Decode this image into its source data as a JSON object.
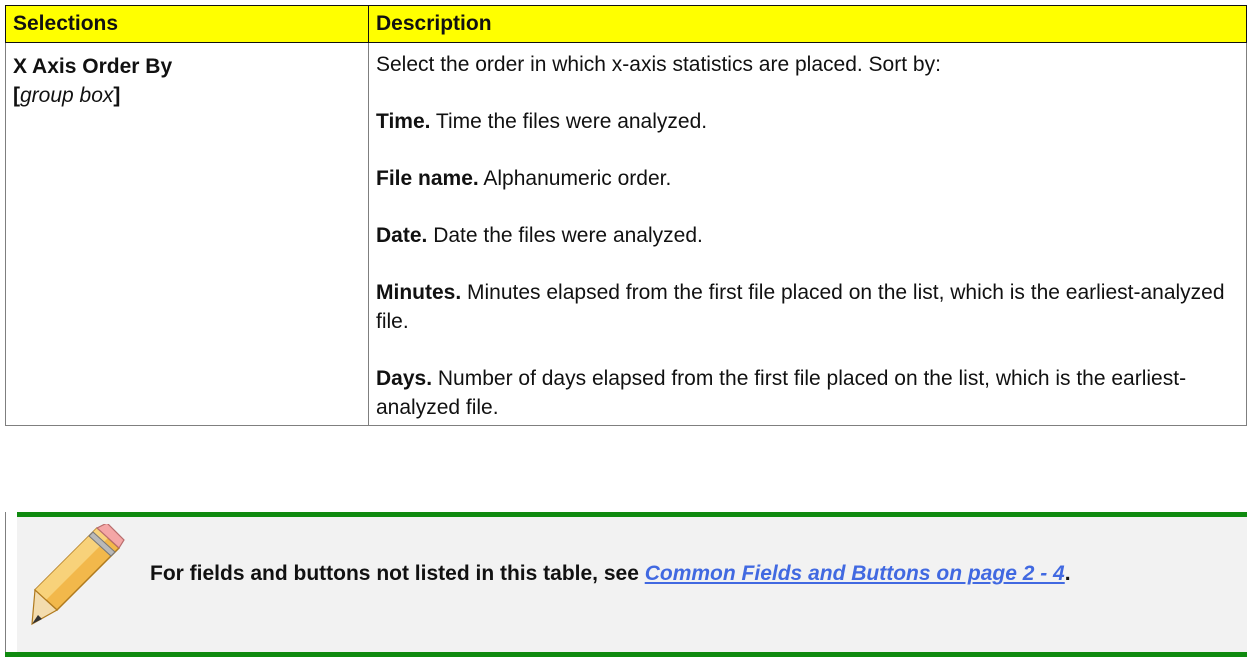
{
  "table": {
    "headers": [
      "Selections",
      "Description"
    ],
    "row": {
      "selection_name": "X Axis Order By",
      "selection_type_open": "[",
      "selection_type": "group box",
      "selection_type_close": "]",
      "intro": "Select the order in which x-axis statistics are placed. Sort by:",
      "options": [
        {
          "label": "Time.",
          "text": " Time the files were analyzed."
        },
        {
          "label": "File name.",
          "text": "  Alphanumeric order."
        },
        {
          "label": "Date.",
          "text": " Date the files were analyzed."
        },
        {
          "label": "Minutes.",
          "text": " Minutes elapsed from the first file placed on the list, which is the earliest-analyzed file."
        },
        {
          "label": "Days.",
          "text": " Number of days elapsed from the first file placed on the list, which is the earliest-analyzed file."
        }
      ]
    }
  },
  "note": {
    "icon": "pencil-icon",
    "text_before": "For fields and buttons not listed in this table, see ",
    "link_text": "Common Fields and Buttons on page 2 - 4",
    "text_after": "."
  },
  "colors": {
    "header_bg": "#ffff00",
    "note_bar": "#0f8a0f",
    "note_bg": "#f2f2f2",
    "link": "#4169e1"
  }
}
